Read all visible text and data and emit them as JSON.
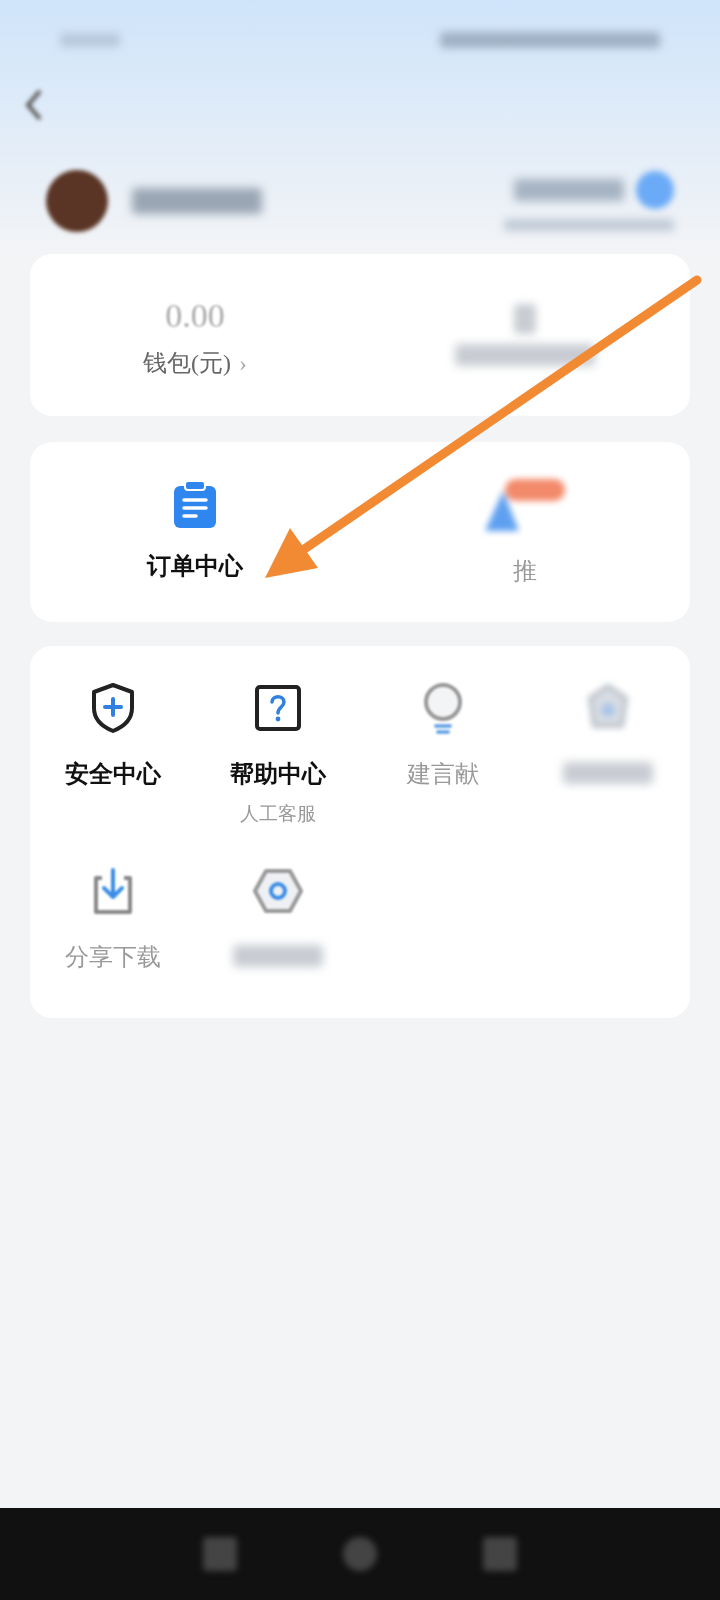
{
  "wallet": {
    "amount": "0.00",
    "label": "钱包(元)",
    "chevron": "›"
  },
  "featured": [
    {
      "label": "订单中心",
      "dimmed": false
    },
    {
      "label": "推",
      "dimmed": true
    }
  ],
  "services": [
    {
      "label": "安全中心",
      "kind": "shield",
      "dimmed": false
    },
    {
      "label": "帮助中心",
      "sub": "人工客服",
      "kind": "help",
      "dimmed": false
    },
    {
      "label": "建言献",
      "kind": "bulb",
      "dimmed": true
    },
    {
      "kind": "gear",
      "dimmed": true
    },
    {
      "label": "分享下载",
      "kind": "download",
      "dimmed": true
    },
    {
      "kind": "hexagon",
      "dimmed": true
    }
  ]
}
